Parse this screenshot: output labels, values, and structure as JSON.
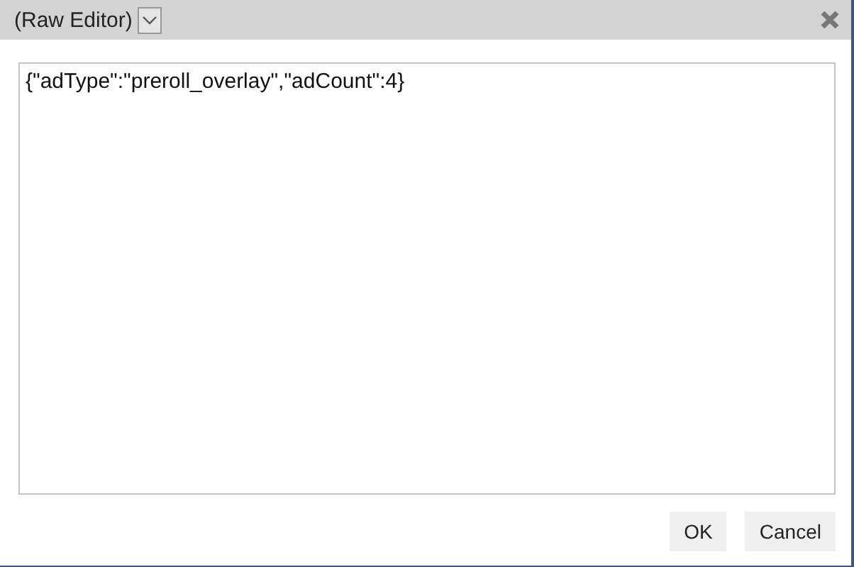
{
  "window": {
    "title": "(Raw Editor)"
  },
  "editor": {
    "value": "{\"adType\":\"preroll_overlay\",\"adCount\":4}"
  },
  "buttons": [
    "OK",
    "Cancel"
  ]
}
